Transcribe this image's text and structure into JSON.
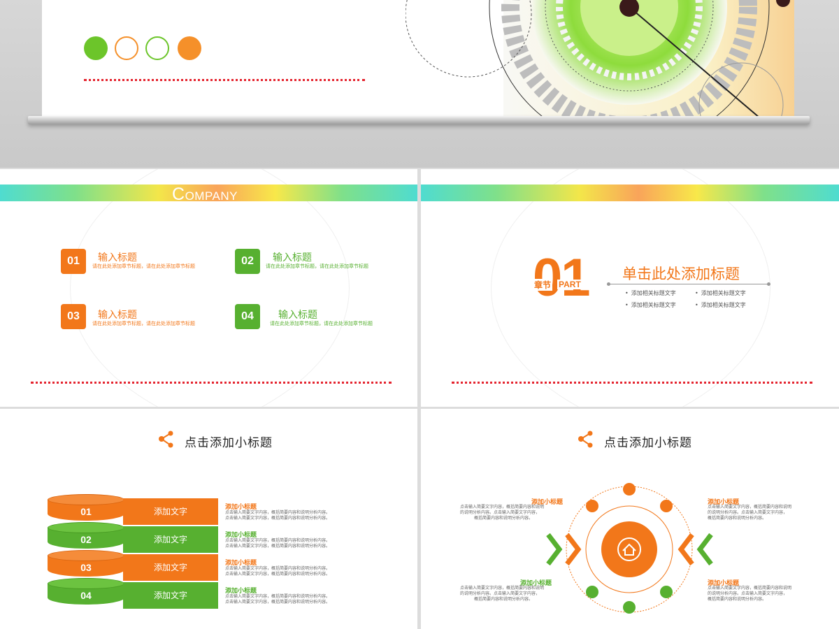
{
  "colors": {
    "orange": "#f2771a",
    "green": "#57b030",
    "red_dots": "#e4232e"
  },
  "slide1": {
    "company": {
      "first": "C",
      "rest": "OMPANY"
    },
    "items": [
      {
        "num": "01",
        "title": "输入标题",
        "desc": "请在此处添加章节标题，请在此处添加章节标题"
      },
      {
        "num": "02",
        "title": "输入标题",
        "desc": "请在此处添加章节标题，请在此处添加章节标题"
      },
      {
        "num": "03",
        "title": "输入标题",
        "desc": "请在此处添加章节标题，请在此处添加章节标题"
      },
      {
        "num": "04",
        "title": "输入标题",
        "desc": "请在此处添加章节标题，请在此处添加章节标题"
      }
    ]
  },
  "slide2": {
    "big_num": "01",
    "label_cn": "章节",
    "label_en": "PART",
    "title": "单击此处添加标题",
    "bullets": [
      "添加相关标题文字",
      "添加相关标题文字",
      "添加相关标题文字",
      "添加相关标题文字"
    ]
  },
  "slide3": {
    "subtitle": "点击添加小标题",
    "rows": [
      {
        "num": "01",
        "bar": "添加文字",
        "title": "添加小标题",
        "line1": "点击输入简要文字内容，概括简要内容和说明分析内容。",
        "line2": "点击输入简要文字内容，概括简要内容和说明分析内容。"
      },
      {
        "num": "02",
        "bar": "添加文字",
        "title": "添加小标题",
        "line1": "点击输入简要文字内容，概括简要内容和说明分析内容。",
        "line2": "点击输入简要文字内容，概括简要内容和说明分析内容。"
      },
      {
        "num": "03",
        "bar": "添加文字",
        "title": "添加小标题",
        "line1": "点击输入简要文字内容，概括简要内容和说明分析内容。",
        "line2": "点击输入简要文字内容，概括简要内容和说明分析内容。"
      },
      {
        "num": "04",
        "bar": "添加文字",
        "title": "添加小标题",
        "line1": "点击输入简要文字内容，概括简要内容和说明分析内容。",
        "line2": "点击输入简要文字内容，概括简要内容和说明分析内容。"
      }
    ]
  },
  "slide4": {
    "subtitle": "点击添加小标题",
    "blocks": [
      {
        "title": "添加小标题",
        "line1": "点击输入简要文字内容，概括简要内容和说明",
        "line2": "的说明分析内容。点击输入简要文字内容，",
        "line3": "概括简要内容和说明分析内容。"
      },
      {
        "title": "添加小标题",
        "line1": "点击输入简要文字内容，概括简要内容和说明",
        "line2": "的说明分析内容。点击输入简要文字内容，",
        "line3": "概括简要内容和说明分析内容。"
      },
      {
        "title": "添加小标题",
        "line1": "点击输入简要文字内容，概括简要内容和说明",
        "line2": "的说明分析内容。点击输入简要文字内容，",
        "line3": "概括简要内容和说明分析内容。"
      },
      {
        "title": "添加小标题",
        "line1": "点击输入简要文字内容，概括简要内容和说明",
        "line2": "的说明分析内容。点击输入简要文字内容，",
        "line3": "概括简要内容和说明分析内容。"
      }
    ],
    "center_icon": "home-icon"
  }
}
